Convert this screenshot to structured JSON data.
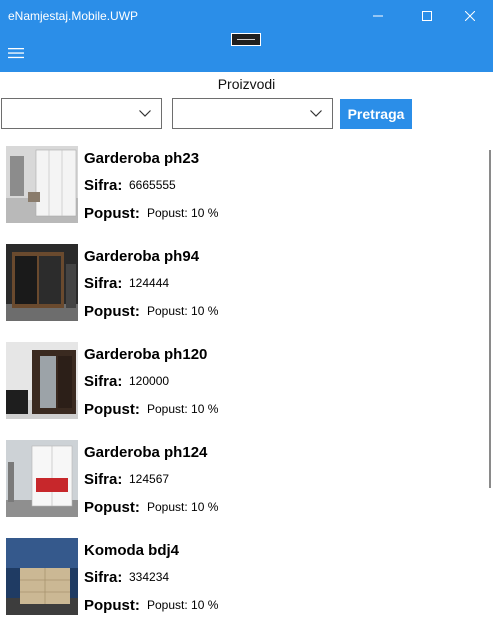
{
  "window": {
    "title": "eNamjestaj.Mobile.UWP",
    "accent": "#2b8ee8",
    "controls": [
      "minimize-icon",
      "maximize-icon",
      "close-icon"
    ]
  },
  "appbar": {
    "menu_icon": "hamburger-icon"
  },
  "page": {
    "title": "Proizvodi"
  },
  "filters": {
    "combo1": {
      "value": ""
    },
    "combo2": {
      "value": ""
    },
    "search_label": "Pretraga"
  },
  "products": [
    {
      "name": "Garderoba ph23",
      "sifra_label": "Sifra:",
      "sifra": "6665555",
      "popust_label": "Popust:",
      "popust": "Popust: 10 %"
    },
    {
      "name": "Garderoba ph94",
      "sifra_label": "Sifra:",
      "sifra": "124444",
      "popust_label": "Popust:",
      "popust": "Popust: 10 %"
    },
    {
      "name": "Garderoba ph120",
      "sifra_label": "Sifra:",
      "sifra": "120000",
      "popust_label": "Popust:",
      "popust": "Popust: 10 %"
    },
    {
      "name": "Garderoba ph124",
      "sifra_label": "Sifra:",
      "sifra": "124567",
      "popust_label": "Popust:",
      "popust": "Popust: 10 %"
    },
    {
      "name": "Komoda bdj4",
      "sifra_label": "Sifra:",
      "sifra": "334234",
      "popust_label": "Popust:",
      "popust": "Popust: 10 %"
    }
  ]
}
